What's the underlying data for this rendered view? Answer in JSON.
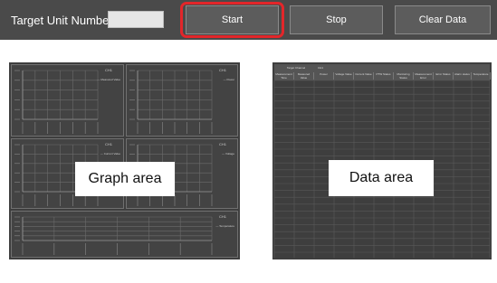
{
  "toolbar": {
    "target_label": "Target Unit Number",
    "target_value": "",
    "start_label": "Start",
    "stop_label": "Stop",
    "clear_label": "Clear Data",
    "highlight_color": "#e3262a"
  },
  "graph_area": {
    "label": "Graph area",
    "graphs": [
      {
        "title": "CH1",
        "legend": "— Measured Value"
      },
      {
        "title": "CH1",
        "legend": "— Power"
      },
      {
        "title": "CH1",
        "legend": "— Current Value"
      },
      {
        "title": "CH1",
        "legend": "— Voltage"
      },
      {
        "title": "CH1",
        "legend": "— Temperature"
      }
    ]
  },
  "data_area": {
    "label": "Data area",
    "header_top": [
      "Target Channel",
      "CH1"
    ],
    "columns": [
      "Measurement Time",
      "Measured Value",
      "Power",
      "Voltage Value",
      "Current Value",
      "PTW Status",
      "Monitoring Status",
      "Measurement Error",
      "Error Status",
      "Alarm status",
      "Temperature"
    ]
  }
}
